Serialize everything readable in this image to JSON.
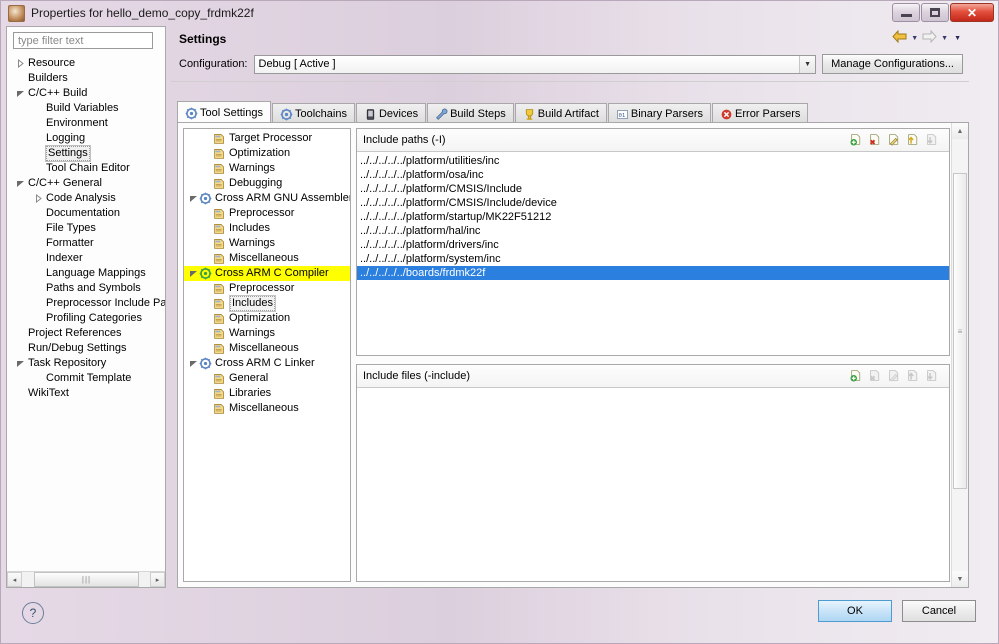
{
  "window": {
    "title": "Properties for hello_demo_copy_frdmk22f",
    "icon": "app-icon",
    "controls": {
      "minimize": "minimize",
      "maximize": "maximize",
      "close": "✕"
    }
  },
  "sidebar": {
    "filter_placeholder": "type filter text",
    "filter_value": "",
    "items": [
      {
        "label": "Resource",
        "indent": 0,
        "arrow": "collapsed"
      },
      {
        "label": "Builders",
        "indent": 0,
        "arrow": "none"
      },
      {
        "label": "C/C++ Build",
        "indent": 0,
        "arrow": "expanded"
      },
      {
        "label": "Build Variables",
        "indent": 1,
        "arrow": "none"
      },
      {
        "label": "Environment",
        "indent": 1,
        "arrow": "none"
      },
      {
        "label": "Logging",
        "indent": 1,
        "arrow": "none"
      },
      {
        "label": "Settings",
        "indent": 1,
        "arrow": "none",
        "selected": true
      },
      {
        "label": "Tool Chain Editor",
        "indent": 1,
        "arrow": "none"
      },
      {
        "label": "C/C++ General",
        "indent": 0,
        "arrow": "expanded"
      },
      {
        "label": "Code Analysis",
        "indent": 1,
        "arrow": "collapsed"
      },
      {
        "label": "Documentation",
        "indent": 1,
        "arrow": "none"
      },
      {
        "label": "File Types",
        "indent": 1,
        "arrow": "none"
      },
      {
        "label": "Formatter",
        "indent": 1,
        "arrow": "none"
      },
      {
        "label": "Indexer",
        "indent": 1,
        "arrow": "none"
      },
      {
        "label": "Language Mappings",
        "indent": 1,
        "arrow": "none"
      },
      {
        "label": "Paths and Symbols",
        "indent": 1,
        "arrow": "none"
      },
      {
        "label": "Preprocessor Include Pa",
        "indent": 1,
        "arrow": "none"
      },
      {
        "label": "Profiling Categories",
        "indent": 1,
        "arrow": "none"
      },
      {
        "label": "Project References",
        "indent": 0,
        "arrow": "none"
      },
      {
        "label": "Run/Debug Settings",
        "indent": 0,
        "arrow": "none"
      },
      {
        "label": "Task Repository",
        "indent": 0,
        "arrow": "expanded"
      },
      {
        "label": "Commit Template",
        "indent": 1,
        "arrow": "none"
      },
      {
        "label": "WikiText",
        "indent": 0,
        "arrow": "none"
      }
    ],
    "hscroll": {
      "left_arrow": "◂",
      "right_arrow": "▸",
      "grip": "|||"
    }
  },
  "page": {
    "title": "Settings",
    "nav": {
      "back_icon": "back-arrow-icon",
      "back_menu_icon": "chevron-down-icon",
      "forward_icon": "forward-arrow-icon",
      "forward_menu_icon": "chevron-down-icon",
      "view_menu_icon": "chevron-down-icon"
    },
    "configuration": {
      "label": "Configuration:",
      "value": "Debug  [ Active ]",
      "dropdown_icon": "▼",
      "manage_button": "Manage Configurations..."
    },
    "tabs": [
      {
        "label": "Tool Settings",
        "icon": "gear-blue-icon",
        "active": true
      },
      {
        "label": "Toolchains",
        "icon": "gear-blue-icon",
        "active": false
      },
      {
        "label": "Devices",
        "icon": "device-icon",
        "active": false
      },
      {
        "label": "Build Steps",
        "icon": "wrench-icon",
        "active": false
      },
      {
        "label": "Build Artifact",
        "icon": "trophy-icon",
        "active": false
      },
      {
        "label": "Binary Parsers",
        "icon": "binary-icon",
        "active": false
      },
      {
        "label": "Error Parsers",
        "icon": "error-icon",
        "active": false
      }
    ]
  },
  "tools_tree": [
    {
      "label": "Target Processor",
      "indent": 1,
      "icon": "page-icon",
      "arrow": "none"
    },
    {
      "label": "Optimization",
      "indent": 1,
      "icon": "page-icon",
      "arrow": "none"
    },
    {
      "label": "Warnings",
      "indent": 1,
      "icon": "page-icon",
      "arrow": "none"
    },
    {
      "label": "Debugging",
      "indent": 1,
      "icon": "page-icon",
      "arrow": "none"
    },
    {
      "label": "Cross ARM GNU Assembler",
      "indent": 0,
      "icon": "gear-blue-icon",
      "arrow": "expanded"
    },
    {
      "label": "Preprocessor",
      "indent": 1,
      "icon": "page-icon",
      "arrow": "none"
    },
    {
      "label": "Includes",
      "indent": 1,
      "icon": "page-icon",
      "arrow": "none"
    },
    {
      "label": "Warnings",
      "indent": 1,
      "icon": "page-icon",
      "arrow": "none"
    },
    {
      "label": "Miscellaneous",
      "indent": 1,
      "icon": "page-icon",
      "arrow": "none"
    },
    {
      "label": "Cross ARM C Compiler",
      "indent": 0,
      "icon": "gear-green-icon",
      "arrow": "expanded",
      "highlighted": true
    },
    {
      "label": "Preprocessor",
      "indent": 1,
      "icon": "page-icon",
      "arrow": "none"
    },
    {
      "label": "Includes",
      "indent": 1,
      "icon": "page-icon",
      "arrow": "none",
      "selected": true
    },
    {
      "label": "Optimization",
      "indent": 1,
      "icon": "page-icon",
      "arrow": "none"
    },
    {
      "label": "Warnings",
      "indent": 1,
      "icon": "page-icon",
      "arrow": "none"
    },
    {
      "label": "Miscellaneous",
      "indent": 1,
      "icon": "page-icon",
      "arrow": "none"
    },
    {
      "label": "Cross ARM C Linker",
      "indent": 0,
      "icon": "gear-blue-icon",
      "arrow": "expanded"
    },
    {
      "label": "General",
      "indent": 1,
      "icon": "page-icon",
      "arrow": "none"
    },
    {
      "label": "Libraries",
      "indent": 1,
      "icon": "page-icon",
      "arrow": "none"
    },
    {
      "label": "Miscellaneous",
      "indent": 1,
      "icon": "page-icon",
      "arrow": "none"
    }
  ],
  "include_paths": {
    "title": "Include paths (-I)",
    "tools": [
      {
        "name": "add-icon",
        "enabled": true
      },
      {
        "name": "delete-icon",
        "enabled": true
      },
      {
        "name": "edit-icon",
        "enabled": true
      },
      {
        "name": "move-up-icon",
        "enabled": true
      },
      {
        "name": "move-down-icon",
        "enabled": false
      }
    ],
    "items": [
      {
        "path": "../../../../../platform/utilities/inc",
        "selected": false
      },
      {
        "path": "../../../../../platform/osa/inc",
        "selected": false
      },
      {
        "path": "../../../../../platform/CMSIS/Include",
        "selected": false
      },
      {
        "path": "../../../../../platform/CMSIS/Include/device",
        "selected": false
      },
      {
        "path": "../../../../../platform/startup/MK22F51212",
        "selected": false
      },
      {
        "path": "../../../../../platform/hal/inc",
        "selected": false
      },
      {
        "path": "../../../../../platform/drivers/inc",
        "selected": false
      },
      {
        "path": "../../../../../platform/system/inc",
        "selected": false
      },
      {
        "path": "../../../../../boards/frdmk22f",
        "selected": true
      }
    ]
  },
  "include_files": {
    "title": "Include files (-include)",
    "tools": [
      {
        "name": "add-icon",
        "enabled": true
      },
      {
        "name": "delete-icon",
        "enabled": false
      },
      {
        "name": "edit-icon",
        "enabled": false
      },
      {
        "name": "move-up-icon",
        "enabled": false
      },
      {
        "name": "move-down-icon",
        "enabled": false
      }
    ],
    "items": []
  },
  "scrollbar": {
    "up_arrow": "▲",
    "down_arrow": "▼",
    "grip": "≡"
  },
  "footer": {
    "help_label": "?",
    "ok_label": "OK",
    "cancel_label": "Cancel"
  },
  "colors": {
    "selection_blue": "#2a7fdf",
    "highlight_yellow": "#ffff00",
    "titlebar": "#e0d2e0",
    "ok_accent": "#4e9bd0"
  }
}
